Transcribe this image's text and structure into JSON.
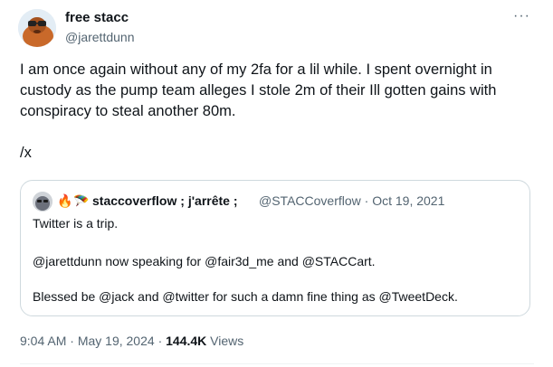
{
  "author": {
    "name": "free stacc",
    "handle": "@jarettdunn"
  },
  "more_label": "···",
  "tweet_text": "I am once again without any of my 2fa for a lil while. I spent overnight in custody as the pump team alleges I stole 2m of their Ill gotten gains with conspiracy to steal another 80m.\n\n/x",
  "quote": {
    "emoji_1": "🔥",
    "emoji_2": "🪂",
    "name": "staccoverflow ; j'arrête ;",
    "handle": "@STACCoverflow",
    "separator": "·",
    "date": "Oct 19, 2021",
    "lines": [
      "Twitter is a trip.",
      "@jarettdunn now speaking for @fair3d_me and @STACCart.",
      "Blessed be @jack and @twitter for such a damn fine thing as @TweetDeck."
    ]
  },
  "footer": {
    "time": "9:04 AM",
    "sep1": "·",
    "date": "May 19, 2024",
    "sep2": "·",
    "views": "144.4K",
    "views_label": "Views"
  }
}
